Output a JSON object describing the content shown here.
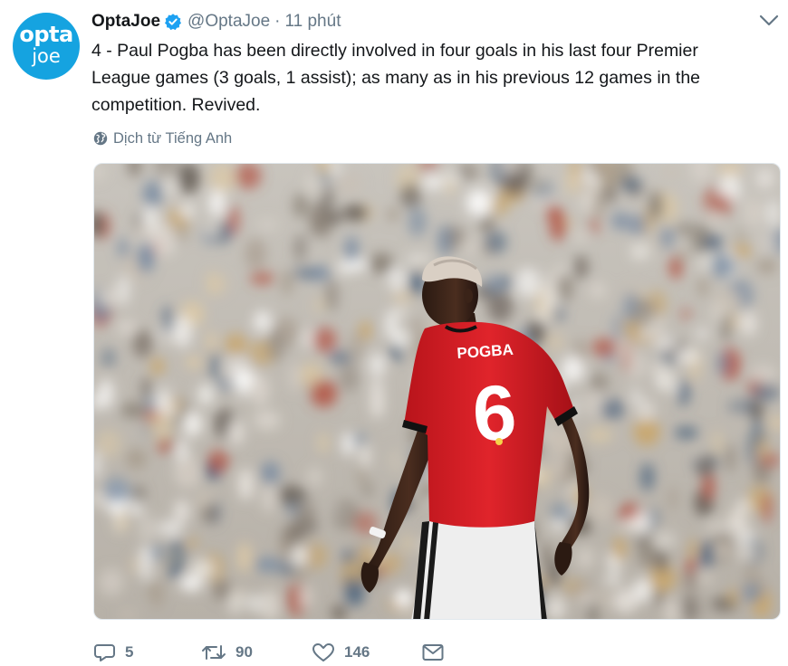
{
  "tweet": {
    "avatar": {
      "line1": "opta",
      "line2": "joe",
      "bg_color": "#15a3e0"
    },
    "display_name": "OptaJoe",
    "verified": true,
    "handle": "@OptaJoe",
    "separator": "·",
    "timestamp": "11 phút",
    "text": "4 - Paul Pogba has been directly involved in four goals in his last four Premier League games (3 goals, 1 assist); as many as in his previous 12 games in the competition. Revived.",
    "translate_label": "Dịch từ Tiếng Anh",
    "media": {
      "jersey_name": "POGBA",
      "jersey_number": "6",
      "shirt_color": "#d81f26"
    },
    "actions": {
      "replies": "5",
      "retweets": "90",
      "likes": "146"
    },
    "icons": [
      "verified-badge-icon",
      "chevron-down-icon",
      "globe-icon",
      "reply-icon",
      "retweet-icon",
      "like-heart-icon",
      "direct-message-icon"
    ],
    "colors": {
      "text": "#14171a",
      "muted": "#657786",
      "verified": "#1da1f2"
    }
  }
}
